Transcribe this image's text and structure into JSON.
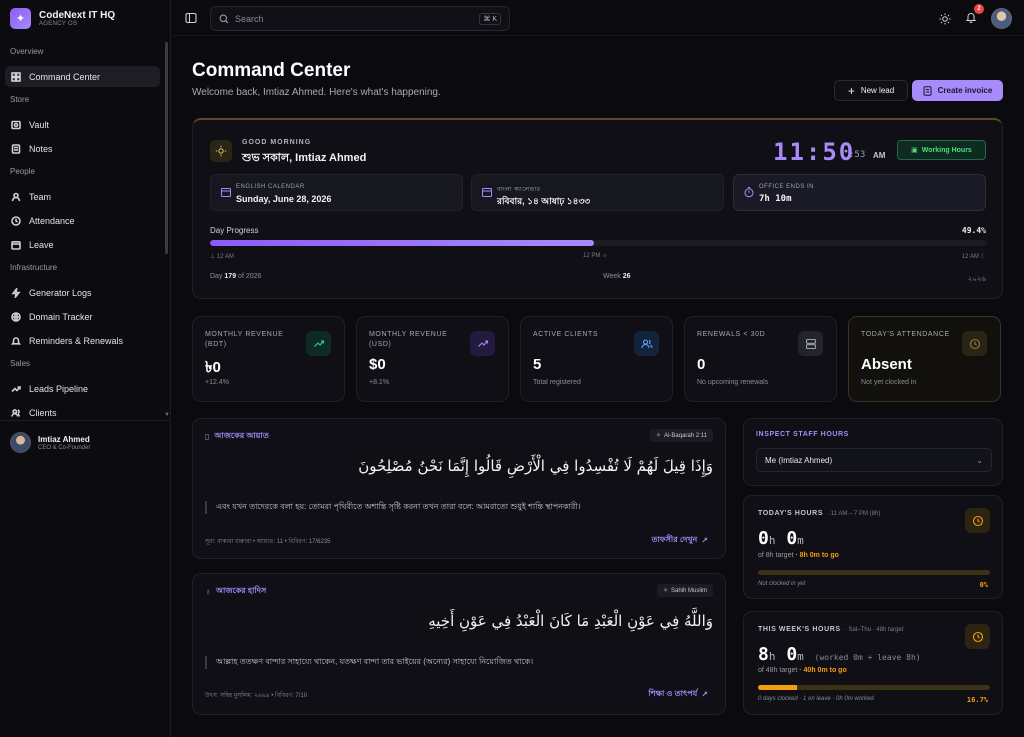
{
  "brand": {
    "name": "CodeNext IT HQ",
    "sub": "AGENCY OS"
  },
  "nav": [
    {
      "section": "Overview"
    },
    {
      "label": "Command Center",
      "icon": "grid-icon",
      "active": true
    },
    {
      "section": "Store"
    },
    {
      "label": "Vault",
      "icon": "vault-icon"
    },
    {
      "label": "Notes",
      "icon": "notes-icon"
    },
    {
      "section": "People"
    },
    {
      "label": "Team",
      "icon": "team-icon"
    },
    {
      "label": "Attendance",
      "icon": "clock-icon"
    },
    {
      "label": "Leave",
      "icon": "calendar-icon"
    },
    {
      "section": "Infrastructure"
    },
    {
      "label": "Generator Logs",
      "icon": "generator-icon"
    },
    {
      "label": "Domain Tracker",
      "icon": "globe-icon"
    },
    {
      "label": "Reminders & Renewals",
      "icon": "bell-icon"
    },
    {
      "section": "Sales"
    },
    {
      "label": "Leads Pipeline",
      "icon": "trend-icon"
    },
    {
      "label": "Clients",
      "icon": "clients-icon"
    }
  ],
  "user": {
    "name": "Imtiaz Ahmed",
    "role": "CEO & Co-Founder"
  },
  "topbar": {
    "search_placeholder": "Search",
    "shortcut": "⌘ K",
    "notif_count": "2"
  },
  "page": {
    "title": "Command Center",
    "subtitle": "Welcome back, Imtiaz Ahmed. Here's what's happening.",
    "new_lead": "New lead",
    "create_invoice": "Create invoice"
  },
  "hero": {
    "greet_label": "GOOD MORNING",
    "greet_name": "শুভ সকাল, Imtiaz Ahmed",
    "time": "11:50",
    "seconds": ":53",
    "ampm": "AM",
    "status": "Working Hours",
    "english_label": "ENGLISH CALENDAR",
    "english_val": "Sunday, June 28, 2026",
    "bangla_label": "বাংলা ক্যালেন্ডার",
    "bangla_val": "রবিবার, ১৪ আষাঢ় ১৪৩৩",
    "office_label": "OFFICE ENDS IN",
    "office_val": "7h 10m",
    "progress_label": "Day Progress",
    "progress_pct": "49.4%",
    "progress_value": 49.4,
    "t1": "12 AM",
    "t2": "12 PM",
    "t3": "12 AM",
    "day_prefix": "Day",
    "day_num": "179",
    "day_suffix": "of 2026",
    "week_prefix": "Week",
    "week_num": "26",
    "bangla_year": "২০২৬"
  },
  "stats": [
    {
      "label": "MONTHLY REVENUE (BDT)",
      "value": "৳0",
      "sub": "+12.4%",
      "icon": "trend-up-icon",
      "icon_color": "#34d399",
      "icon_bg": "#0f2a22"
    },
    {
      "label": "MONTHLY REVENUE (USD)",
      "value": "$0",
      "sub": "+8.1%",
      "icon": "trend-up-icon",
      "icon_color": "#a78bfa",
      "icon_bg": "#231b3d"
    },
    {
      "label": "ACTIVE CLIENTS",
      "value": "5",
      "sub": "Total registered",
      "icon": "users-icon",
      "icon_color": "#60a5fa",
      "icon_bg": "#132339"
    },
    {
      "label": "RENEWALS < 30D",
      "value": "0",
      "sub": "No upcoming renewals",
      "icon": "server-icon",
      "icon_color": "#9ca3af",
      "icon_bg": "#23232b"
    },
    {
      "label": "TODAY'S ATTENDANCE",
      "value": "Absent",
      "sub": "Not yet clocked in",
      "icon": "clock-icon",
      "icon_color": "#8b7a3a",
      "icon_bg": "#2a2416"
    }
  ],
  "ayah": {
    "title": "আজকের আয়াত",
    "ref": "Al-Baqarah 2:11",
    "arabic": "وَإِذَا قِيلَ لَهُمْ لَا تُفْسِدُوا فِي الْأَرْضِ قَالُوا إِنَّمَا نَحْنُ مُصْلِحُونَ",
    "translation": "এবং যখন তাদেরকে বলা হয়: তোমরা পৃথিবীতে অশান্তি সৃষ্টি করনা তখন তারা বলে: আমরাতো শুধুই শান্তি স্থাপনকারী।",
    "source": "সূরা: বাকারা বাক্বারা • আয়াত: 11 • বিবিরণ: 17/6235",
    "link": "তাফসীর দেখুন"
  },
  "hadith": {
    "title": "আজকের হাদিস",
    "ref": "Sahih Muslim",
    "arabic": "وَاللَّهُ فِي عَوْنِ الْعَبْدِ مَا كَانَ الْعَبْدُ فِي عَوْنِ أَخِيهِ",
    "translation": "আল্লাহ ততক্ষণ বান্দার সাহায্যে থাকেন, যতক্ষণ বান্দা তার ভাইয়ের (অন্যের) সাহায্যে নিয়োজিত থাকে।",
    "source": "উৎস: সহিহ মুসলিম: ২৬৯৯ • বিবিরণ: 7/10",
    "link": "শিক্ষা ও তাৎপর্য"
  },
  "staff": {
    "title": "INSPECT STAFF HOURS",
    "selected": "Me (Imtiaz Ahmed)"
  },
  "today_hours": {
    "title": "TODAY'S HOURS",
    "range": "· 11 AM – 7 PM (8h)",
    "h": "0",
    "m": "0",
    "target_prefix": "of 8h target",
    "target": "· 8h 0m to go",
    "note": "Not clocked in yet",
    "pct": "0%",
    "progress": 0
  },
  "week_hours": {
    "title": "THIS WEEK'S HOURS",
    "range": "· Sat–Thu · 48h target",
    "h": "8",
    "m": "0",
    "extra": "(worked 0m + leave 8h)",
    "target_prefix": "of 48h target",
    "target": "· 40h 0m to go",
    "note": "0 days clocked · 1 on leave · 0h 0m worked",
    "pct": "16.7%",
    "progress": 16.7
  }
}
